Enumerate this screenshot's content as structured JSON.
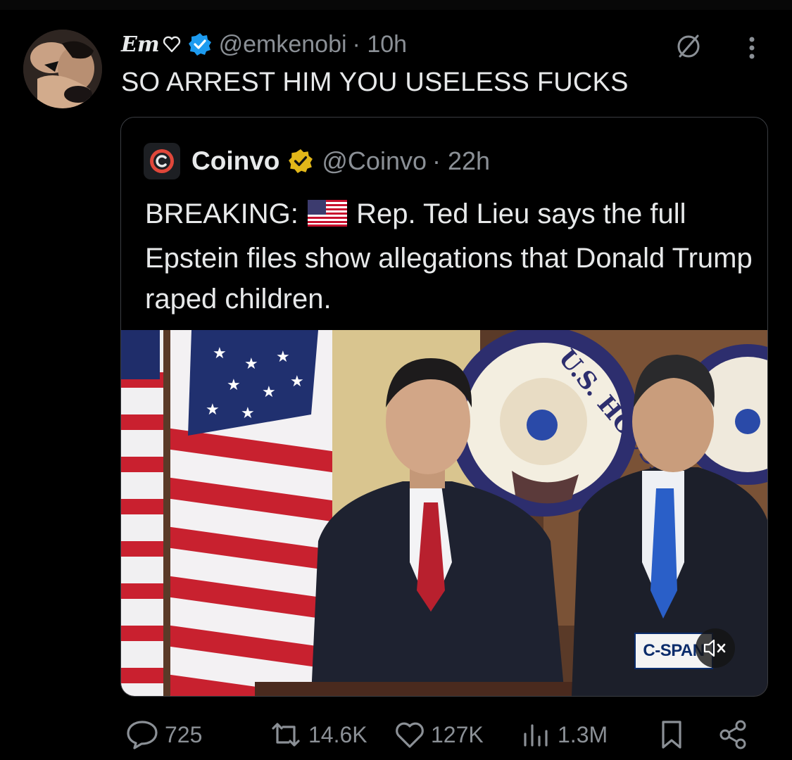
{
  "tweet": {
    "display_name": "Em",
    "handle": "@emkenobi",
    "time": "· 10h",
    "text": "SO ARREST HIM YOU USELESS FUCKS"
  },
  "quoted": {
    "name": "Coinvo",
    "handle": "@Coinvo",
    "time": "· 22h",
    "text_prefix": "BREAKING:",
    "text_body": "Rep. Ted Lieu says the full Epstein files show allegations that Donald Trump raped children."
  },
  "media": {
    "watermark": "C-SPAN",
    "seal_text": "U.S. HOUSE"
  },
  "actions": {
    "replies": "725",
    "reposts": "14.6K",
    "likes": "127K",
    "views": "1.3M"
  },
  "colors": {
    "background": "#000000",
    "text": "#e7e9ea",
    "secondary": "#8b9096",
    "verified_blue": "#1d9bf0",
    "gold_badge": "#e2b719"
  },
  "icons": [
    "heart-outline-icon",
    "verified-badge-icon",
    "grok-icon",
    "more-icon",
    "coinvo-logo-icon",
    "gold-verified-icon",
    "us-flag-icon",
    "mute-icon",
    "reply-icon",
    "repost-icon",
    "like-icon",
    "views-icon",
    "bookmark-icon",
    "share-icon"
  ]
}
